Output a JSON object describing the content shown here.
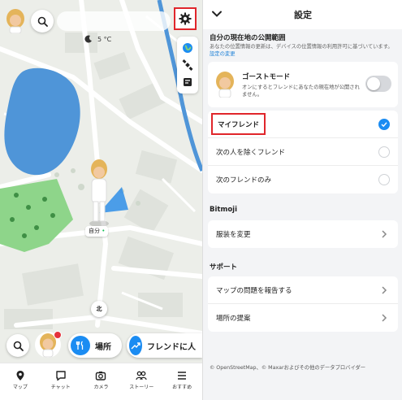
{
  "map": {
    "weather_temp": "5 °C",
    "me_label": "自分",
    "compass_label": "北",
    "places_label": "場所",
    "friends_label": "フレンドに人"
  },
  "nav": {
    "items": [
      {
        "label": "マップ"
      },
      {
        "label": "チャット"
      },
      {
        "label": "カメラ"
      },
      {
        "label": "ストーリー"
      },
      {
        "label": "おすすめ"
      }
    ]
  },
  "settings": {
    "title": "設定",
    "location_section_title": "自分の現在地の公開範囲",
    "location_desc": "あなたの位置情報の更新は、デバイスの位置情報の利用許可に基づいています。",
    "location_desc_link": "設定の変更",
    "ghost_mode_title": "ゴーストモード",
    "ghost_mode_desc": "オンにするとフレンドにあなたの現在地が公開されません。",
    "options": [
      {
        "label": "マイフレンド",
        "selected": true
      },
      {
        "label": "次の人を除くフレンド",
        "selected": false
      },
      {
        "label": "次のフレンドのみ",
        "selected": false
      }
    ],
    "bitmoji_title": "Bitmoji",
    "change_outfit": "服装を変更",
    "support_title": "サポート",
    "report_map_issue": "マップの問題を報告する",
    "suggest_place": "場所の提案",
    "footer": "© OpenStreetMap、© Maxarおよびその他のデータプロバイダー"
  },
  "colors": {
    "highlight_red": "#e0262b",
    "accent_blue": "#1b8cf2",
    "water_blue": "#4f95d8",
    "park_green": "#8ed58a"
  }
}
